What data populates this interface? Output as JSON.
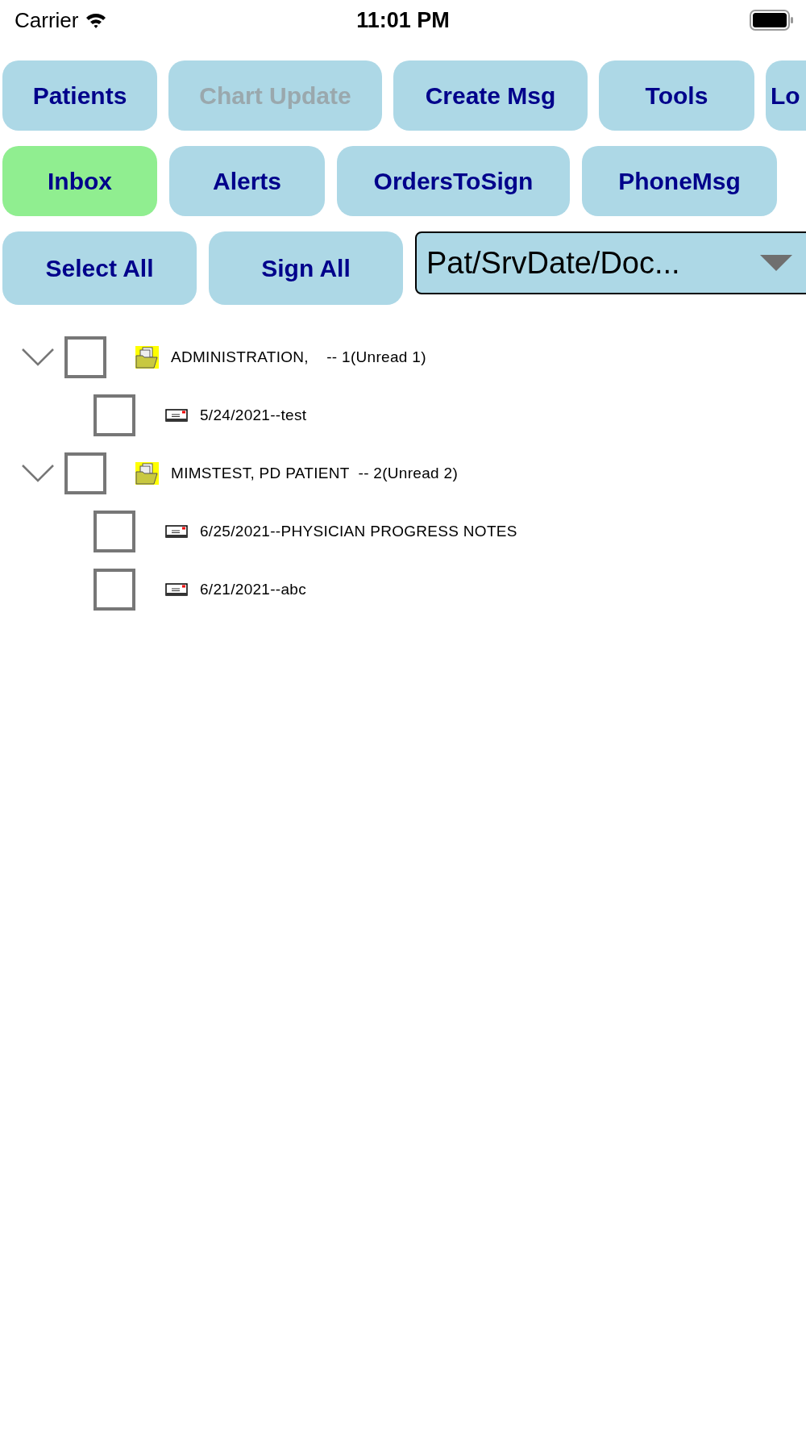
{
  "status_bar": {
    "carrier": "Carrier",
    "time": "11:01 PM"
  },
  "toolbar": [
    {
      "label": "Patients",
      "disabled": false
    },
    {
      "label": "Chart Update",
      "disabled": true
    },
    {
      "label": "Create Msg",
      "disabled": false
    },
    {
      "label": "Tools",
      "disabled": false
    },
    {
      "label": "Lo",
      "disabled": false
    }
  ],
  "tabs": [
    {
      "label": "Inbox",
      "selected": true
    },
    {
      "label": "Alerts",
      "selected": false
    },
    {
      "label": "OrdersToSign",
      "selected": false
    },
    {
      "label": "PhoneMsg",
      "selected": false
    }
  ],
  "actions": [
    "Select All",
    "Sign All"
  ],
  "sort_dropdown": {
    "value": "Pat/SrvDate/Doc..."
  },
  "tree": [
    {
      "label": "ADMINISTRATION,    -- 1(Unread 1)",
      "expanded": true,
      "checked": false,
      "children": [
        {
          "label": "5/24/2021--test",
          "checked": false
        }
      ]
    },
    {
      "label": "MIMSTEST, PD PATIENT  -- 2(Unread 2)",
      "expanded": true,
      "checked": false,
      "children": [
        {
          "label": "6/25/2021--PHYSICIAN PROGRESS NOTES",
          "checked": false
        },
        {
          "label": "6/21/2021--abc",
          "checked": false
        }
      ]
    }
  ]
}
